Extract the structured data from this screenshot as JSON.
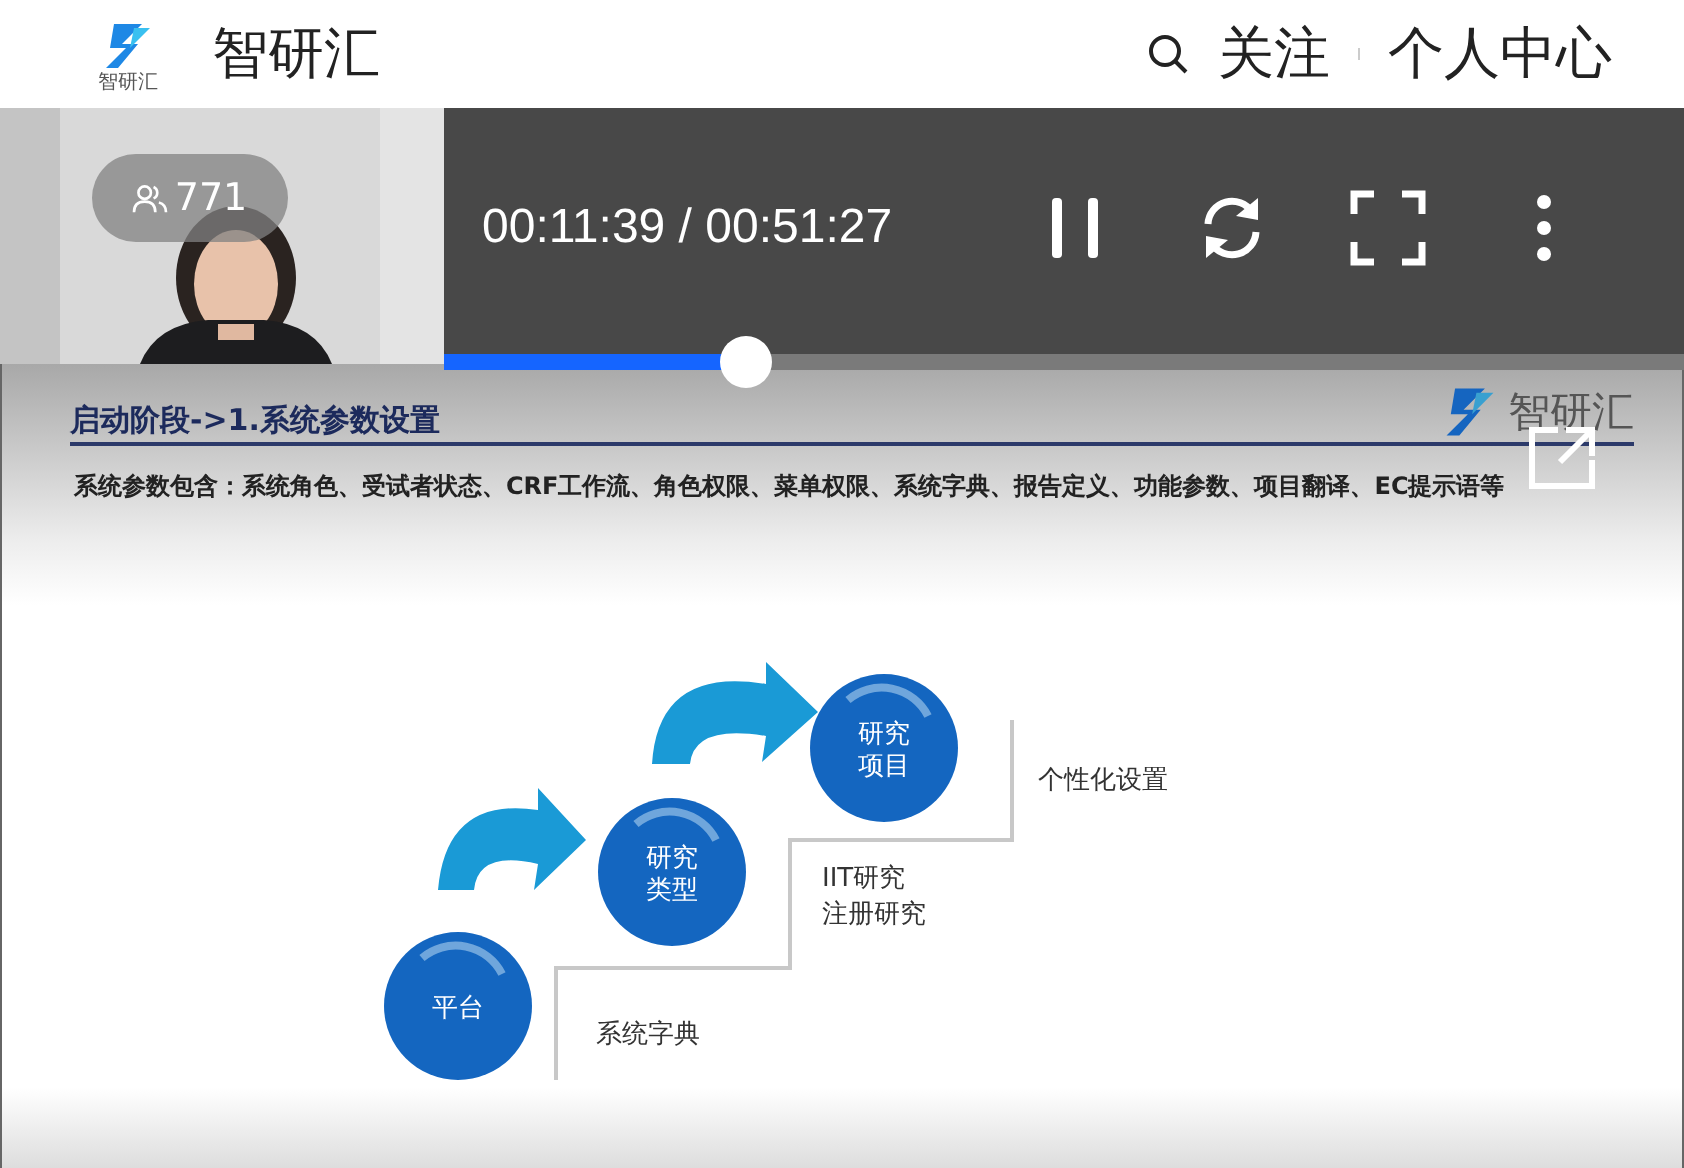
{
  "header": {
    "logo_caption": "智研汇",
    "title": "智研汇",
    "nav": [
      "关注",
      "个人中心"
    ]
  },
  "live": {
    "viewer_count": "771",
    "time": "00:11:39 / 00:51:27",
    "playing": true,
    "progress": {
      "level": 0.244
    }
  },
  "slide": {
    "title": "启动阶段->1.系统参数设置",
    "brand": "智研汇",
    "intro_label": "系统参数包含：",
    "intro_text": "系统角色、受试者状态、CRF工作流、角色权限、菜单权限、系统字典、报告定义、功能参数、项目翻译、EC提示语等",
    "steps": [
      {
        "label": [
          "平台"
        ],
        "note": [
          "系统字典"
        ]
      },
      {
        "label": [
          "研究",
          "类型"
        ],
        "note": [
          "IIT研究",
          "注册研究"
        ]
      },
      {
        "label": [
          "研究",
          "项目"
        ],
        "note": [
          "个性化设置"
        ]
      }
    ]
  }
}
